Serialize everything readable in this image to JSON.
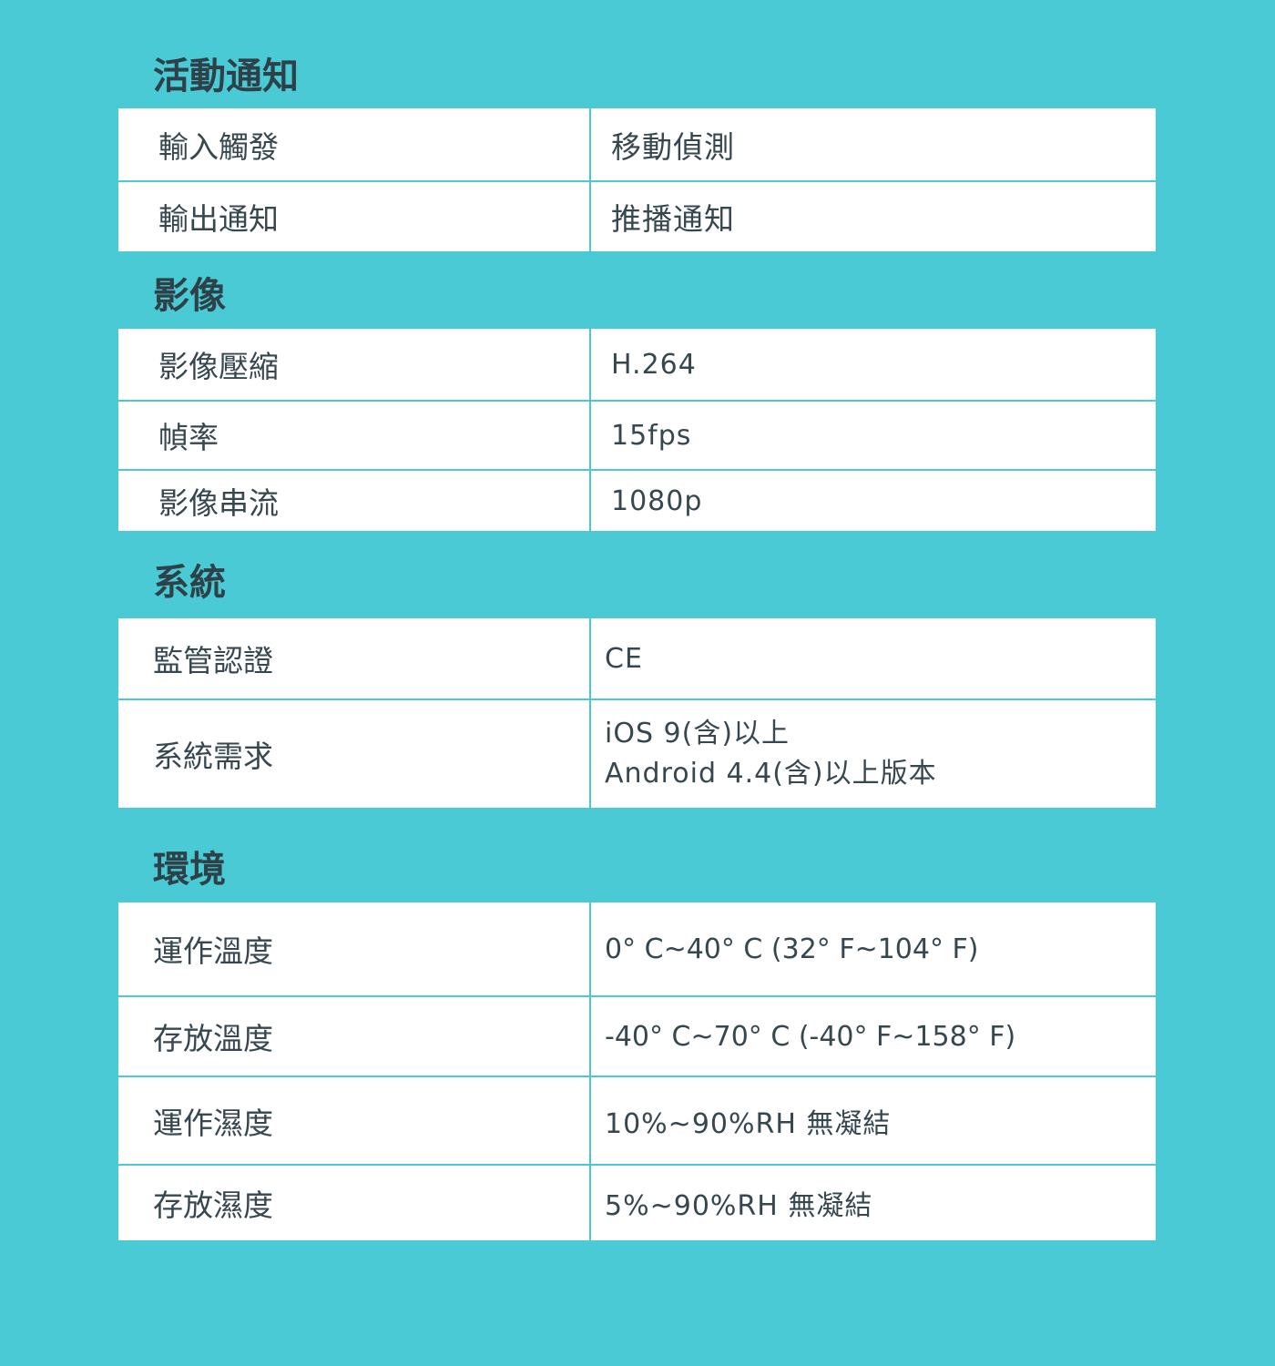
{
  "sections": [
    {
      "title": "活動通知",
      "rows": [
        {
          "label": "輸入觸發",
          "value": "移動偵測"
        },
        {
          "label": "輸出通知",
          "value": "推播通知"
        }
      ]
    },
    {
      "title": "影像",
      "rows": [
        {
          "label": "影像壓縮",
          "value": "H.264"
        },
        {
          "label": "幀率",
          "value": "15fps"
        },
        {
          "label": "影像串流",
          "value": "1080p"
        }
      ]
    },
    {
      "title": "系統",
      "rows": [
        {
          "label": "監管認證",
          "value": "CE"
        },
        {
          "label": "系統需求",
          "value_lines": [
            "iOS 9(含)以上",
            "Android 4.4(含)以上版本"
          ]
        }
      ]
    },
    {
      "title": "環境",
      "rows": [
        {
          "label": "運作溫度",
          "value": "0° C~40° C (32° F~104° F)"
        },
        {
          "label": "存放溫度",
          "value": "-40° C~70° C (-40° F~158° F)"
        },
        {
          "label": "運作濕度",
          "value": "10%~90%RH 無凝結"
        },
        {
          "label": "存放濕度",
          "value": "5%~90%RH 無凝結"
        }
      ]
    }
  ]
}
